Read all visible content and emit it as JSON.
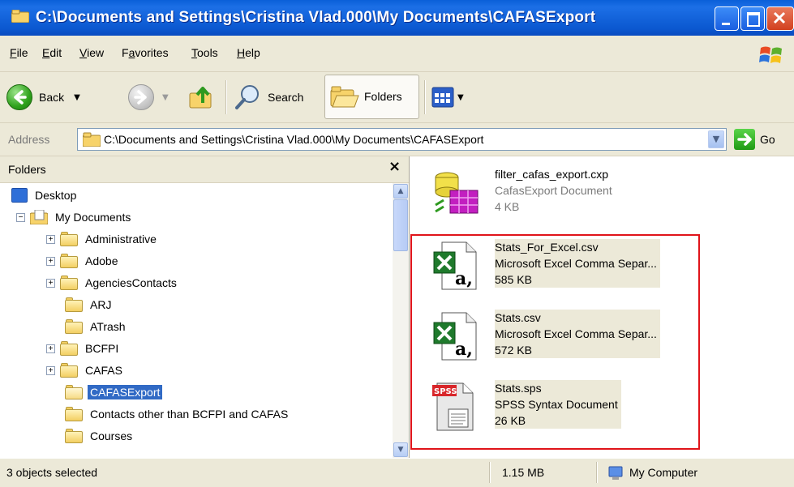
{
  "window": {
    "title": "C:\\Documents and Settings\\Cristina Vlad.000\\My Documents\\CAFASExport"
  },
  "menu": [
    {
      "label": "File",
      "key": "F",
      "rest": "ile"
    },
    {
      "label": "Edit",
      "key": "E",
      "rest": "dit"
    },
    {
      "label": "View",
      "key": "V",
      "rest": "iew"
    },
    {
      "label": "Favorites",
      "key": "a",
      "pre": "F",
      "rest": "vorites"
    },
    {
      "label": "Tools",
      "key": "T",
      "rest": "ools"
    },
    {
      "label": "Help",
      "key": "H",
      "rest": "elp"
    }
  ],
  "toolbar": {
    "back_label": "Back",
    "search_label": "Search",
    "folders_label": "Folders"
  },
  "address": {
    "label": "Address",
    "value": "C:\\Documents and Settings\\Cristina Vlad.000\\My Documents\\CAFASExport",
    "go_label": "Go"
  },
  "folders_pane": {
    "title": "Folders",
    "close": "×",
    "tree": [
      {
        "label": "Desktop",
        "level": 0,
        "expander": "",
        "icon": "desktop-icon"
      },
      {
        "label": "My Documents",
        "level": 1,
        "expander": "−",
        "icon": "my-documents-icon"
      },
      {
        "label": "Administrative",
        "level": 2,
        "expander": "+",
        "icon": "folder-icon"
      },
      {
        "label": "Adobe",
        "level": 2,
        "expander": "+",
        "icon": "folder-icon"
      },
      {
        "label": "AgenciesContacts",
        "level": 2,
        "expander": "+",
        "icon": "folder-icon"
      },
      {
        "label": "ARJ",
        "level": 2,
        "expander": "",
        "icon": "folder-icon"
      },
      {
        "label": "ATrash",
        "level": 2,
        "expander": "",
        "icon": "folder-icon"
      },
      {
        "label": "BCFPI",
        "level": 2,
        "expander": "+",
        "icon": "folder-icon"
      },
      {
        "label": "CAFAS",
        "level": 2,
        "expander": "+",
        "icon": "folder-icon"
      },
      {
        "label": "CAFASExport",
        "level": 2,
        "expander": "",
        "icon": "folder-open-icon",
        "selected": true
      },
      {
        "label": "Contacts other than BCFPI and CAFAS",
        "level": 2,
        "expander": "",
        "icon": "folder-icon"
      },
      {
        "label": "Courses",
        "level": 2,
        "expander": "",
        "icon": "folder-icon"
      }
    ]
  },
  "files": [
    {
      "name": "filter_cafas_export.cxp",
      "type": "CafasExport Document",
      "size": "4 KB",
      "icon": "cafas-export-icon",
      "selected": false
    },
    {
      "name": "Stats_For_Excel.csv",
      "type": "Microsoft Excel Comma Separ...",
      "size": "585 KB",
      "icon": "excel-csv-icon",
      "selected": true
    },
    {
      "name": "Stats.csv",
      "type": "Microsoft Excel Comma Separ...",
      "size": "572 KB",
      "icon": "excel-csv-icon",
      "selected": true
    },
    {
      "name": "Stats.sps",
      "type": "SPSS Syntax Document",
      "size": "26 KB",
      "icon": "spss-syntax-icon",
      "selected": true
    }
  ],
  "status": {
    "selection": "3 objects selected",
    "size": "1.15 MB",
    "location": "My Computer"
  },
  "colors": {
    "titlebar": "#0A5FD8",
    "selection": "#316AC5",
    "highlight_box": "#E0141A",
    "chrome": "#ECE9D8"
  }
}
